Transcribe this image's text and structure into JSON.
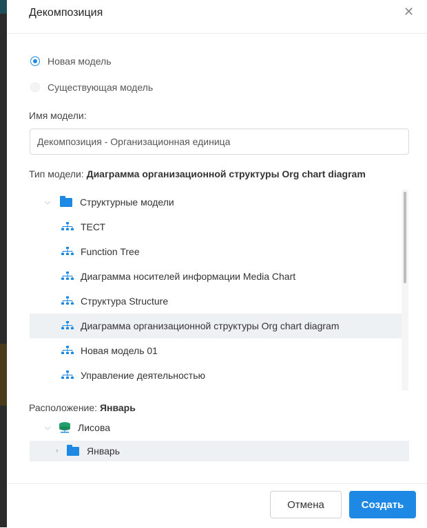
{
  "dialog": {
    "title": "Декомпозиция"
  },
  "options": {
    "new_model": "Новая модель",
    "existing_model": "Существующая модель",
    "selected": "new_model"
  },
  "model_name": {
    "label": "Имя модели:",
    "value": "Декомпозиция - Организационная единица"
  },
  "model_type": {
    "label": "Тип модели: ",
    "value": "Диаграмма организационной структуры Org chart diagram"
  },
  "tree": {
    "folder": "Структурные модели",
    "items": [
      "ТЕСТ",
      "Function Tree",
      "Диаграмма носителей информации Media Chart",
      "Структура Structure",
      "Диаграмма организационной структуры Org chart diagram",
      "Новая модель 01",
      "Управление деятельностью"
    ],
    "selected_index": 4
  },
  "location": {
    "label": "Расположение: ",
    "value": "Январь",
    "db": "Лисова",
    "folder": "Январь"
  },
  "buttons": {
    "cancel": "Отмена",
    "create": "Создать"
  },
  "colors": {
    "accent": "#1e88e5",
    "selected_row": "#eef1f4",
    "db_icon": "#22a06b"
  }
}
